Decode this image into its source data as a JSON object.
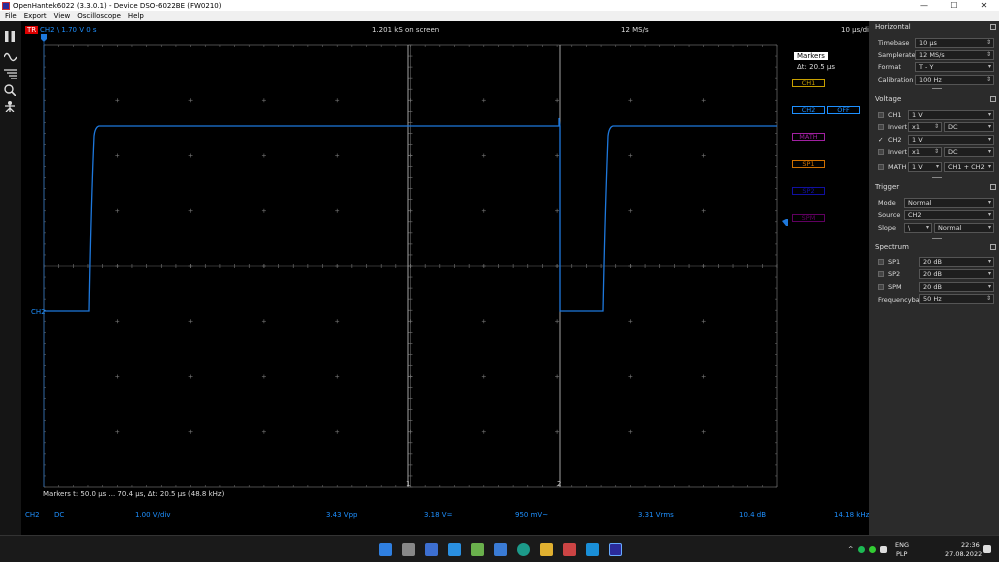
{
  "window": {
    "title": "OpenHantek6022 (3.3.0.1) - Device DSO-6022BE (FW0210)",
    "controls": [
      "—",
      "☐",
      "✕"
    ]
  },
  "menu": [
    "File",
    "Export",
    "View",
    "Oscilloscope",
    "Help"
  ],
  "toolbar": [
    "pause-icon",
    "waveform-icon",
    "settings-list-icon",
    "zoom-icon",
    "measure-icon"
  ],
  "scope": {
    "trigger_badge": "TR",
    "trigger_info": "CH2  \\  1.70 V  0 s",
    "samples_on_screen": "1.201 kS on screen",
    "samplerate": "12 MS/s",
    "timebase": "10 µs/div",
    "markers_title": "Markers",
    "markers_dt": "Δt: 20.5 µs",
    "channel_labels": [
      {
        "text": "CH1",
        "color": "#c8a000"
      },
      {
        "text": "CH2",
        "color": "#1e90ff"
      },
      {
        "text": "OFF",
        "color": "#1e90ff"
      },
      {
        "text": "MATH",
        "color": "#a020a0"
      },
      {
        "text": "SP1",
        "color": "#d07000"
      },
      {
        "text": "SP2",
        "color": "#1010a0"
      },
      {
        "text": "SPM",
        "color": "#600060"
      }
    ],
    "trace_label": "CH2",
    "marker_1": "1",
    "marker_2": "2",
    "markers_info": "Markers   t: 50.0 µs ... 70.4 µs,  Δt: 20.5 µs (48.8 kHz)",
    "status": {
      "channel": "CH2",
      "coupling": "DC",
      "vdiv": "1.00 V/div",
      "vpp": "3.43 Vpp",
      "vmean": "3.18 V=",
      "vac": "950 mV~",
      "vrms": "3.31 Vrms",
      "db": "10.4 dB",
      "freq": "14.18 kHz"
    },
    "trace_color": "#1e78dc"
  },
  "horizontal": {
    "title": "Horizontal",
    "timebase_label": "Timebase",
    "timebase_value": "10 µs",
    "samplerate_label": "Samplerate",
    "samplerate_value": "12 MS/s",
    "format_label": "Format",
    "format_value": "T - Y",
    "calibration_label": "Calibration out",
    "calibration_value": "100 Hz"
  },
  "voltage": {
    "title": "Voltage",
    "ch1_label": "CH1",
    "ch1_gain": "1 V",
    "invert1_label": "Invert",
    "invert1_probe": "x1",
    "invert1_coupling": "DC",
    "ch2_label": "CH2",
    "ch2_check": "✓",
    "ch2_gain": "1 V",
    "invert2_label": "Invert",
    "invert2_probe": "x1",
    "invert2_coupling": "DC",
    "math_label": "MATH",
    "math_gain": "1 V",
    "math_mode": "CH1 + CH2"
  },
  "trigger": {
    "title": "Trigger",
    "mode_label": "Mode",
    "mode_value": "Normal",
    "source_label": "Source",
    "source_value": "CH2",
    "slope_label": "Slope",
    "slope_value": "\\",
    "slope_mode": "Normal"
  },
  "spectrum": {
    "title": "Spectrum",
    "sp1_label": "SP1",
    "sp1_value": "20 dB",
    "sp2_label": "SP2",
    "sp2_value": "20 dB",
    "spm_label": "SPM",
    "spm_value": "20 dB",
    "freqbase_label": "Frequencybase",
    "freqbase_value": "50 Hz"
  },
  "taskbar": {
    "lang1": "ENG",
    "lang2": "PLP",
    "time": "22:36",
    "date": "27.08.2022",
    "tray_arrow": "^"
  }
}
